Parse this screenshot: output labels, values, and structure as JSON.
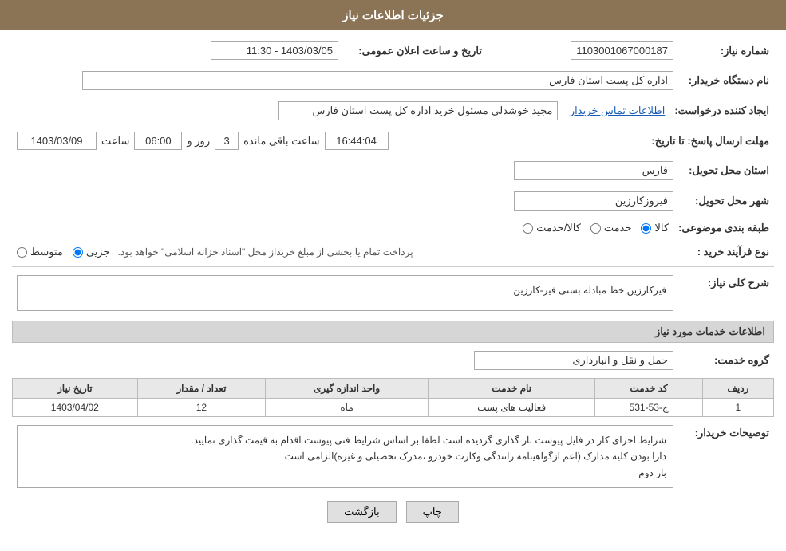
{
  "header": {
    "title": "جزئیات اطلاعات نیاز"
  },
  "fields": {
    "need_number_label": "شماره نیاز:",
    "need_number_value": "1103001067000187",
    "buyer_org_label": "نام دستگاه خریدار:",
    "buyer_org_value": "اداره کل پست استان فارس",
    "requester_label": "ایجاد کننده درخواست:",
    "requester_value": "مجید خوشدلی مسئول خرید اداره کل پست استان فارس",
    "requester_contact_link": "اطلاعات تماس خریدار",
    "response_deadline_label": "مهلت ارسال پاسخ: تا تاریخ:",
    "response_date": "1403/03/09",
    "response_time_label": "ساعت",
    "response_time": "06:00",
    "response_day_label": "روز و",
    "response_days": "3",
    "remaining_label": "ساعت باقی مانده",
    "remaining_time": "16:44:04",
    "province_label": "استان محل تحویل:",
    "province_value": "فارس",
    "city_label": "شهر محل تحویل:",
    "city_value": "فیروزکارزین",
    "category_label": "طبقه بندی موضوعی:",
    "category_options": [
      "کالا",
      "خدمت",
      "کالا/خدمت"
    ],
    "category_selected": "کالا",
    "purchase_type_label": "نوع فرآیند خرید :",
    "purchase_type_options": [
      "جزیی",
      "متوسط"
    ],
    "purchase_type_selected": "جزیی",
    "purchase_type_note": "پرداخت تمام یا بخشی از مبلغ خریداز محل \"اسناد خزانه اسلامی\" خواهد بود.",
    "announcement_date_label": "تاریخ و ساعت اعلان عمومی:",
    "announcement_date_value": "1403/03/05 - 11:30",
    "need_description_label": "شرح کلی نیاز:",
    "need_description_value": "فیرکارزین خط مبادله بستی فیر-کارزین",
    "services_info_label": "اطلاعات خدمات مورد نیاز",
    "service_group_label": "گروه خدمت:",
    "service_group_value": "حمل و نقل و انبارداری",
    "table_headers": {
      "row_num": "ردیف",
      "service_code": "کد خدمت",
      "service_name": "نام خدمت",
      "unit_measurement": "واحد اندازه گیری",
      "quantity": "تعداد / مقدار",
      "need_date": "تاریخ نیاز"
    },
    "table_rows": [
      {
        "row": "1",
        "code": "ج-53-531",
        "name": "فعالیت های پست",
        "unit": "ماه",
        "quantity": "12",
        "date": "1403/04/02"
      }
    ],
    "buyer_desc_label": "توصیحات خریدار:",
    "buyer_desc_value": "شرایط اجرای کار در فایل پیوست بار گذاری گردیده است لطفا بر اساس شرایط فنی پیوست اقدام به قیمت گذاری نمایید.\nدارا بودن کلیه مدارک (اعم ازگواهینامه رانندگی وکارت خودرو ،مدرک تحصیلی و غیره)الزامی است\nبار دوم"
  },
  "buttons": {
    "print": "چاپ",
    "back": "بازگشت"
  }
}
